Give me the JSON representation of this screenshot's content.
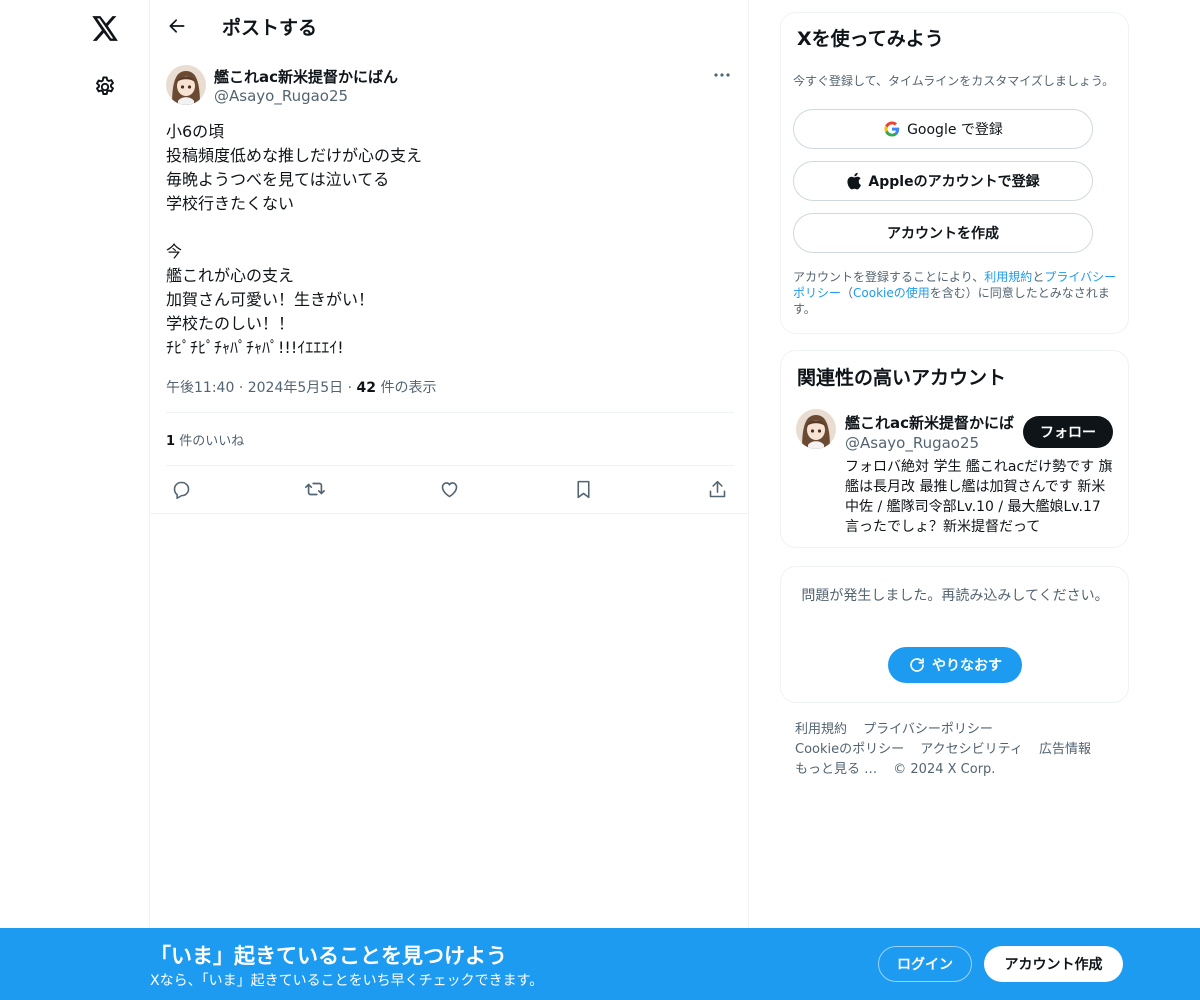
{
  "nav": {
    "logo_icon": "x-logo-icon",
    "settings_icon": "gear-icon"
  },
  "header": {
    "title": "ポストする"
  },
  "tweet": {
    "author_name": "艦これac新米提督かにばん",
    "author_handle": "@Asayo_Rugao25",
    "lines": [
      "小6の頃",
      "投稿頻度低めな推しだけが心の支え",
      "毎晩ようつべを見ては泣いてる",
      "学校行きたくない",
      "",
      "今",
      "艦これが心の支え",
      "加賀さん可愛い！生きがい！",
      "学校たのしい！！",
      "ﾁﾋﾟﾁﾋﾟﾁｬﾊﾟﾁｬﾊﾟ!!!ｲｴｴｴｲ!"
    ],
    "time": "午後11:40",
    "date": "2024年5月5日",
    "views_count": "42",
    "views_label": "件の表示",
    "likes_count": "1",
    "likes_label": "件のいいね"
  },
  "signup": {
    "title": "Xを使ってみよう",
    "subtitle": "今すぐ登録して、タイムラインをカスタマイズしましょう。",
    "google_label": "Google で登録",
    "apple_label": "Appleのアカウントで登録",
    "create_label": "アカウントを作成",
    "terms_prefix": "アカウントを登録することにより、",
    "terms_link": "利用規約",
    "terms_and": "と",
    "privacy_link": "プライバシーポリシー",
    "terms_open": "（",
    "cookie_link": "Cookieの使用",
    "terms_suffix": "を含む）に同意したとみなされます。"
  },
  "related": {
    "title": "関連性の高いアカウント",
    "name": "艦これac新米提督かにば",
    "handle": "@Asayo_Rugao25",
    "follow_label": "フォロー",
    "bio": "フォロバ絶対 学生 艦これacだけ勢です 旗艦は長月改 最推し艦は加賀さんです 新米中佐 / 艦隊司令部Lv.10 / 最大艦娘Lv.17 言ったでしょ？新米提督だって"
  },
  "error": {
    "message": "問題が発生しました。再読み込みしてください。",
    "retry_label": "やりなおす"
  },
  "footer": {
    "terms": "利用規約",
    "privacy": "プライバシーポリシー",
    "cookie": "Cookieのポリシー",
    "accessibility": "アクセシビリティ",
    "ads": "広告情報",
    "more": "もっと見る …",
    "copyright": "© 2024 X Corp."
  },
  "bottom_bar": {
    "title": "「いま」起きていることを見つけよう",
    "subtitle": "Xなら、「いま」起きていることをいち早くチェックできます。",
    "login_label": "ログイン",
    "create_label": "アカウント作成"
  },
  "colors": {
    "accent": "#1d9bf0",
    "text": "#0f1419",
    "secondary": "#536471",
    "border": "#eff3f4"
  }
}
